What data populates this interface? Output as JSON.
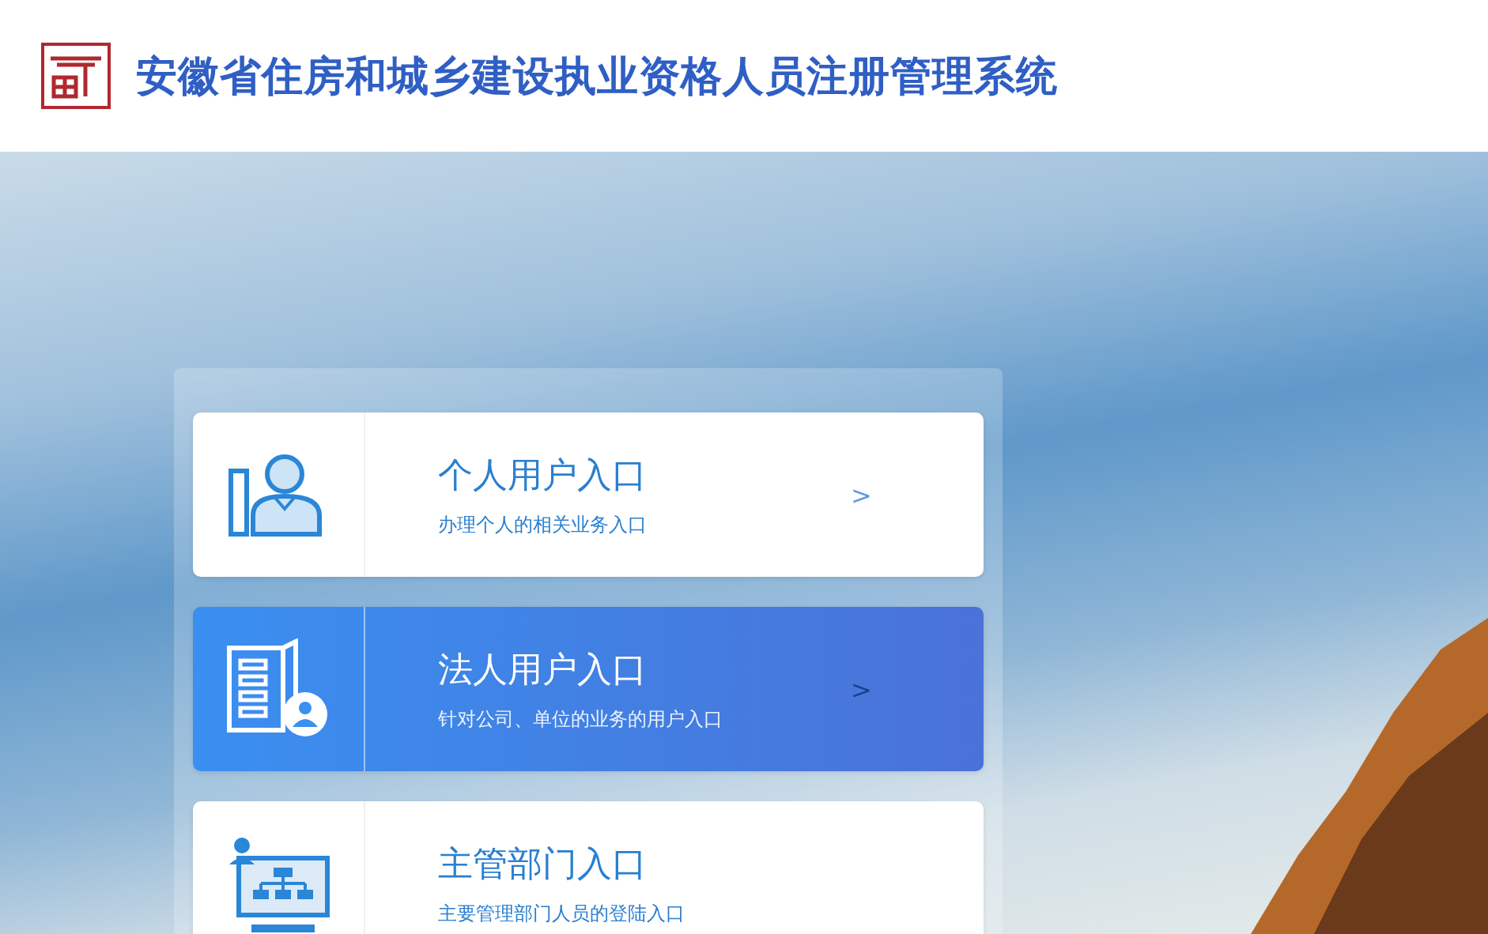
{
  "header": {
    "title": "安徽省住房和城乡建设执业资格人员注册管理系统"
  },
  "entries": [
    {
      "kind": "person",
      "title": "个人用户入口",
      "subtitle": "办理个人的相关业务入口",
      "arrow": ">",
      "selected": false
    },
    {
      "kind": "company",
      "title": "法人用户入口",
      "subtitle": "针对公司、单位的业务的用户入口",
      "arrow": ">",
      "selected": true
    },
    {
      "kind": "department",
      "title": "主管部门入口",
      "subtitle": "主要管理部门人员的登陆入口",
      "selected": false
    }
  ]
}
